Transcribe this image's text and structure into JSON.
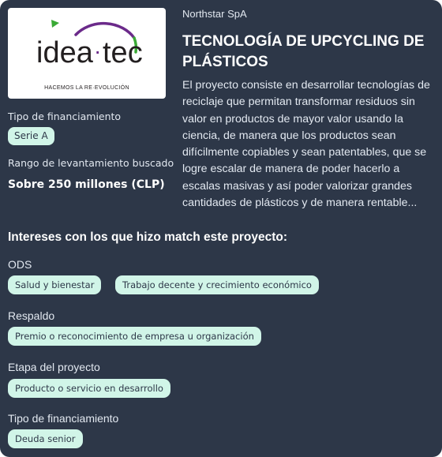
{
  "logo": {
    "brand_left": "idea",
    "brand_dot": "·",
    "brand_right": "tec",
    "tagline": "HACEMOS LA RE·EVOLUCIÓN",
    "colors": {
      "purple": "#6b2a8a",
      "green": "#3aaa35",
      "dark": "#231f20"
    }
  },
  "funding": {
    "label": "Tipo de financiamiento",
    "badge": "Serie A"
  },
  "raise": {
    "label": "Rango de levantamiento buscado",
    "amount": "Sobre 250 millones (CLP)"
  },
  "project": {
    "company": "Northstar SpA",
    "title": "TECNOLOGÍA DE UPCYCLING DE PLÁSTICOS",
    "description": "El proyecto consiste en desarrollar tecnologías de reciclaje que permitan transformar residuos sin valor en productos de mayor valor usando la ciencia, de manera que los productos sean difícilmente copiables y sean patentables, que se logre escalar de manera de poder hacerlo a escalas masivas y así poder valorizar grandes cantidades de plásticos y de manera rentable..."
  },
  "matches": {
    "title": "Intereses con los que hizo match este proyecto:",
    "ods": {
      "label": "ODS",
      "tags": [
        "Salud y bienestar",
        "Trabajo decente y crecimiento económico"
      ]
    },
    "respaldo": {
      "label": "Respaldo",
      "tags": [
        "Premio o reconocimiento de empresa u organización"
      ]
    },
    "etapa": {
      "label": "Etapa del proyecto",
      "tags": [
        "Producto o servicio en desarrollo"
      ]
    },
    "financiamiento": {
      "label": "Tipo de financiamiento",
      "tags": [
        "Deuda senior"
      ]
    }
  },
  "theme": {
    "card_bg": "#2d3748",
    "pill_bg": "#d1f5e8"
  }
}
